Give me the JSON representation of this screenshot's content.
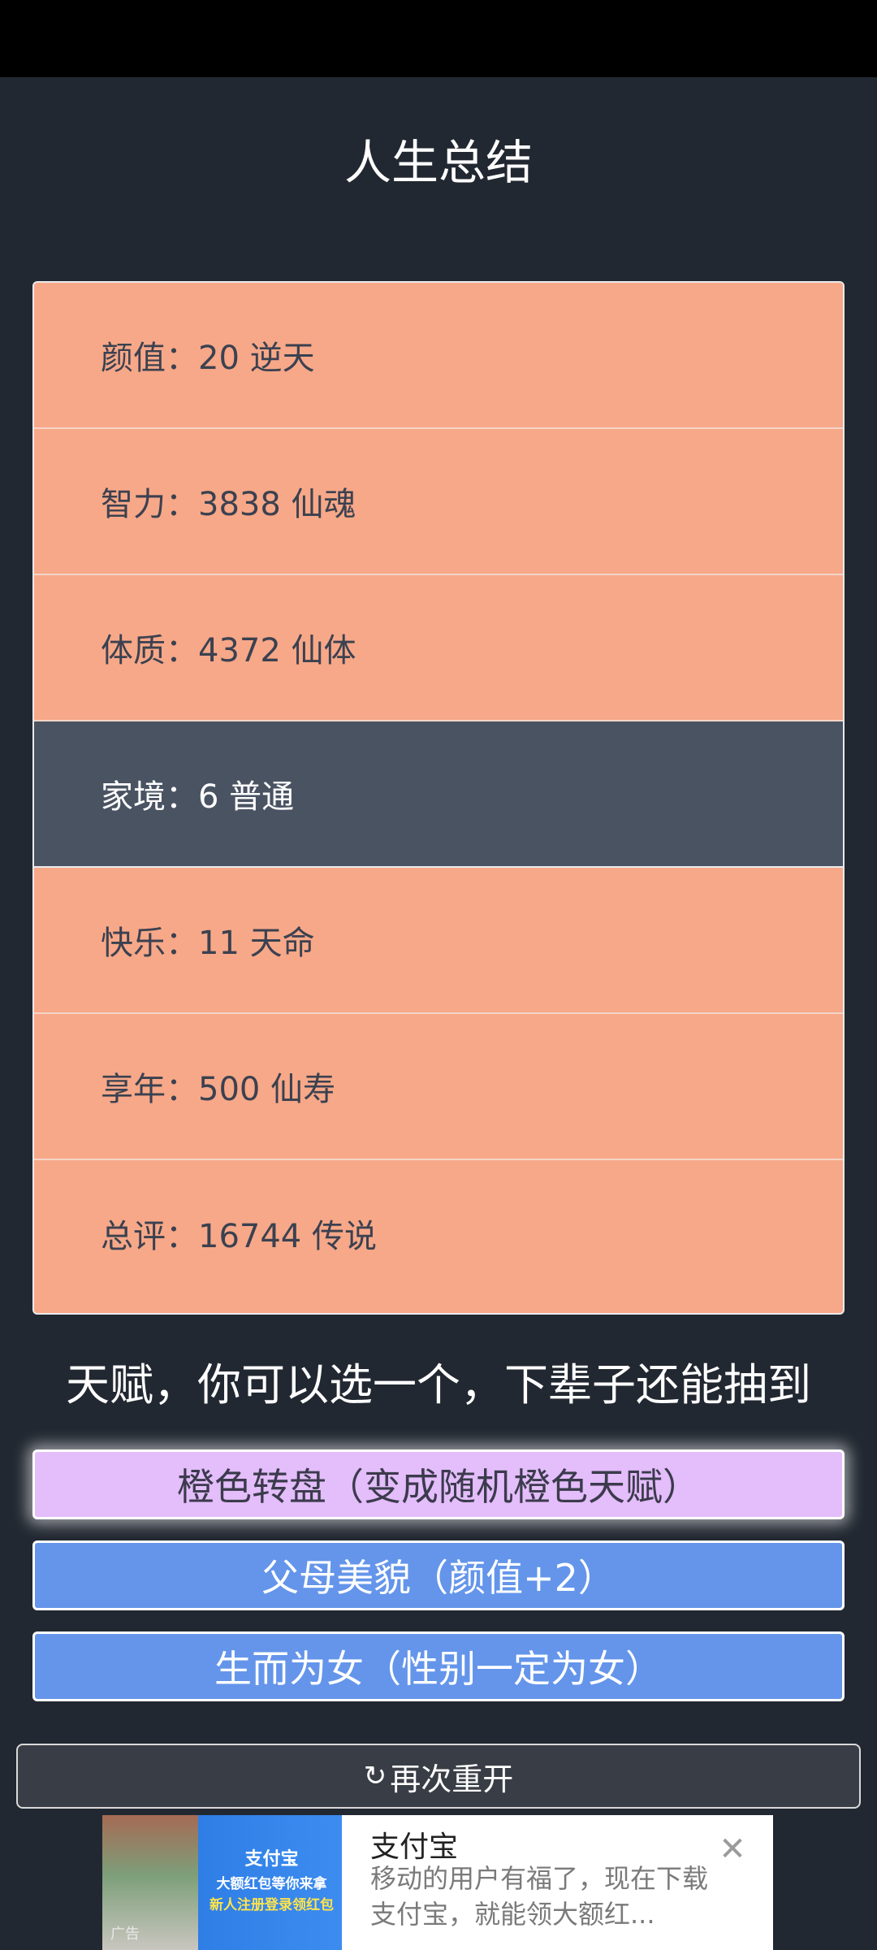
{
  "page": {
    "title": "人生总结"
  },
  "summary": [
    {
      "label": "颜值：20 逆天",
      "highlight": false
    },
    {
      "label": "智力：3838 仙魂",
      "highlight": false
    },
    {
      "label": "体质：4372 仙体",
      "highlight": false
    },
    {
      "label": "家境：6 普通",
      "highlight": true
    },
    {
      "label": "快乐：11 天命",
      "highlight": false
    },
    {
      "label": "享年：500 仙寿",
      "highlight": false
    },
    {
      "label": "总评：16744 传说",
      "highlight": false
    }
  ],
  "talents": {
    "heading": "天赋，你可以选一个，下辈子还能抽到",
    "options": [
      {
        "label": "橙色转盘（变成随机橙色天赋）",
        "selected": true
      },
      {
        "label": "父母美貌（颜值+2）",
        "selected": false
      },
      {
        "label": "生而为女（性别一定为女）",
        "selected": false
      }
    ]
  },
  "restart": {
    "icon": "restart-icon",
    "label": "再次重开"
  },
  "ad": {
    "image_brand": "支付宝",
    "image_line1": "大额红包等你来拿",
    "image_line2": "新人注册登录领红包",
    "image_tag": "广告",
    "title": "支付宝",
    "description": "移动的用户有福了，现在下载支付宝，就能领大额红...",
    "close_icon": "close-icon"
  },
  "colors": {
    "background": "#222831",
    "row": "#f7a888",
    "row_highlight": "#4a5362",
    "selected_talent": "#e4bdfb",
    "talent": "#6495ea",
    "restart": "#393e46"
  }
}
